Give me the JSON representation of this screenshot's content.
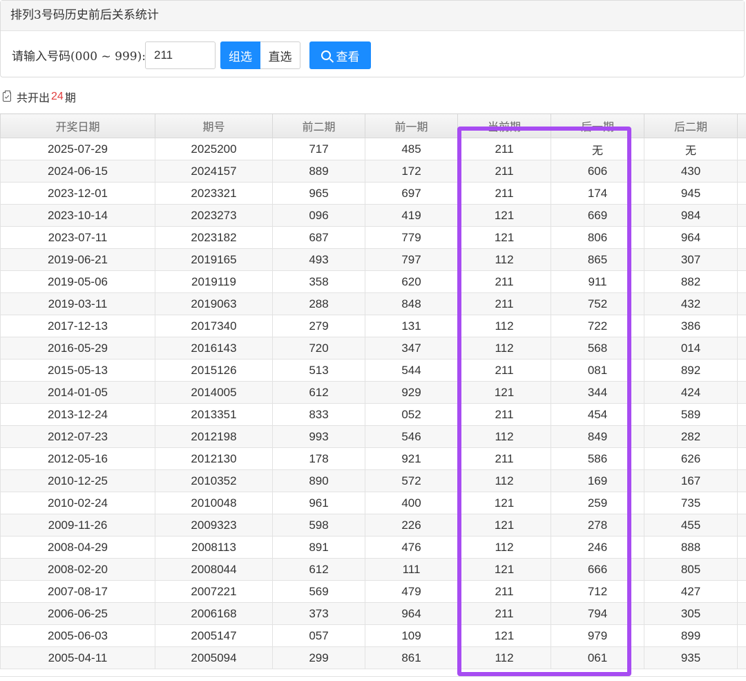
{
  "header": {
    "title": "排列3号码历史前后关系统计"
  },
  "form": {
    "label": "请输入号码(000 ~ 999):",
    "input_value": "211",
    "btn_group": "组选",
    "btn_direct": "直选",
    "btn_view": "查看"
  },
  "summary": {
    "prefix": "共开出",
    "count": "24",
    "suffix": "期"
  },
  "table": {
    "headers": [
      "开奖日期",
      "期号",
      "前二期",
      "前一期",
      "当前期",
      "后一期",
      "后二期",
      ""
    ],
    "rows": [
      [
        "2025-07-29",
        "2025200",
        "717",
        "485",
        "211",
        "无",
        "无"
      ],
      [
        "2024-06-15",
        "2024157",
        "889",
        "172",
        "211",
        "606",
        "430"
      ],
      [
        "2023-12-01",
        "2023321",
        "965",
        "697",
        "211",
        "174",
        "945"
      ],
      [
        "2023-10-14",
        "2023273",
        "096",
        "419",
        "121",
        "669",
        "984"
      ],
      [
        "2023-07-11",
        "2023182",
        "687",
        "779",
        "121",
        "806",
        "964"
      ],
      [
        "2019-06-21",
        "2019165",
        "493",
        "797",
        "112",
        "865",
        "307"
      ],
      [
        "2019-05-06",
        "2019119",
        "358",
        "620",
        "211",
        "911",
        "882"
      ],
      [
        "2019-03-11",
        "2019063",
        "288",
        "848",
        "211",
        "752",
        "432"
      ],
      [
        "2017-12-13",
        "2017340",
        "279",
        "131",
        "112",
        "722",
        "386"
      ],
      [
        "2016-05-29",
        "2016143",
        "720",
        "347",
        "112",
        "568",
        "014"
      ],
      [
        "2015-05-13",
        "2015126",
        "513",
        "544",
        "211",
        "081",
        "892"
      ],
      [
        "2014-01-05",
        "2014005",
        "612",
        "929",
        "121",
        "344",
        "424"
      ],
      [
        "2013-12-24",
        "2013351",
        "833",
        "052",
        "211",
        "454",
        "589"
      ],
      [
        "2012-07-23",
        "2012198",
        "993",
        "546",
        "112",
        "849",
        "282"
      ],
      [
        "2012-05-16",
        "2012130",
        "178",
        "921",
        "211",
        "586",
        "626"
      ],
      [
        "2010-12-25",
        "2010352",
        "890",
        "572",
        "112",
        "169",
        "167"
      ],
      [
        "2010-02-24",
        "2010048",
        "961",
        "400",
        "121",
        "259",
        "735"
      ],
      [
        "2009-11-26",
        "2009323",
        "598",
        "226",
        "121",
        "278",
        "455"
      ],
      [
        "2008-04-29",
        "2008113",
        "891",
        "476",
        "112",
        "246",
        "888"
      ],
      [
        "2008-02-20",
        "2008044",
        "612",
        "111",
        "121",
        "666",
        "805"
      ],
      [
        "2007-08-17",
        "2007221",
        "569",
        "479",
        "211",
        "712",
        "427"
      ],
      [
        "2006-06-25",
        "2006168",
        "373",
        "964",
        "211",
        "794",
        "305"
      ],
      [
        "2005-06-03",
        "2005147",
        "057",
        "109",
        "121",
        "979",
        "899"
      ],
      [
        "2005-04-11",
        "2005094",
        "299",
        "861",
        "112",
        "061",
        "935"
      ]
    ]
  },
  "colors": {
    "primary_button": "#1a8cff",
    "count_text": "#e03c3c",
    "highlight_box": "#a74cf2"
  }
}
